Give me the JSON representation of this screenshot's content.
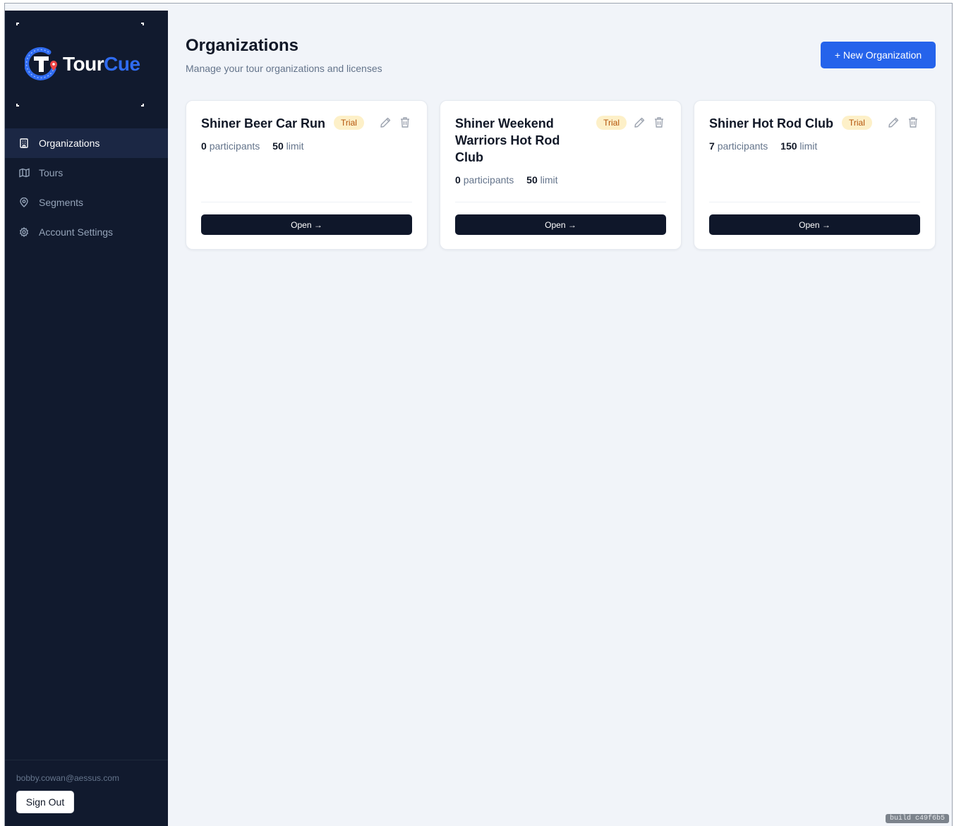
{
  "brand": {
    "name_part1": "Tour",
    "name_part2": "Cue",
    "accent_color": "#2f6bf0"
  },
  "sidebar": {
    "items": [
      {
        "label": "Organizations",
        "icon": "building-icon",
        "active": true
      },
      {
        "label": "Tours",
        "icon": "map-icon",
        "active": false
      },
      {
        "label": "Segments",
        "icon": "map-pin-icon",
        "active": false
      },
      {
        "label": "Account Settings",
        "icon": "gear-icon",
        "active": false
      }
    ],
    "user_email": "bobby.cowan@aessus.com",
    "sign_out_label": "Sign Out"
  },
  "header": {
    "title": "Organizations",
    "subtitle": "Manage your tour organizations and licenses",
    "new_button_label": "+ New Organization"
  },
  "organizations": [
    {
      "name": "Shiner Beer Car Run",
      "badge": "Trial",
      "participants_count": "0",
      "participants_label": "participants",
      "limit_count": "50",
      "limit_label": "limit",
      "open_label": "Open →"
    },
    {
      "name": "Shiner Weekend Warriors Hot Rod Club",
      "badge": "Trial",
      "participants_count": "0",
      "participants_label": "participants",
      "limit_count": "50",
      "limit_label": "limit",
      "open_label": "Open →"
    },
    {
      "name": "Shiner Hot Rod Club",
      "badge": "Trial",
      "participants_count": "7",
      "participants_label": "participants",
      "limit_count": "150",
      "limit_label": "limit",
      "open_label": "Open →"
    }
  ],
  "build_tag": "build c49f6b5",
  "colors": {
    "sidebar_bg": "#111a2e",
    "primary_button": "#2563eb",
    "open_button": "#0f172a",
    "trial_badge_bg": "#fdf0c8",
    "trial_badge_text": "#b45309"
  }
}
